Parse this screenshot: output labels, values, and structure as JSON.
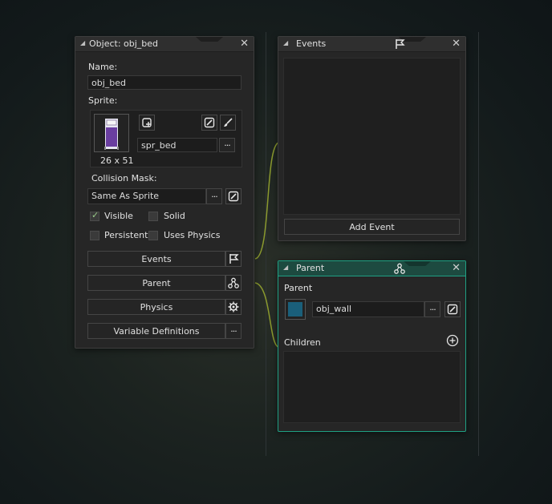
{
  "object_panel": {
    "title": "Object: obj_bed",
    "name_label": "Name:",
    "name_value": "obj_bed",
    "sprite_label": "Sprite:",
    "sprite_name": "spr_bed",
    "sprite_size": "26 x 51",
    "collision_label": "Collision Mask:",
    "collision_value": "Same As Sprite",
    "checkboxes": [
      {
        "label": "Visible",
        "checked": true
      },
      {
        "label": "Solid",
        "checked": false
      },
      {
        "label": "Persistent",
        "checked": false
      },
      {
        "label": "Uses Physics",
        "checked": false
      }
    ],
    "buttons": {
      "events": "Events",
      "parent": "Parent",
      "physics": "Physics",
      "variable_definitions": "Variable Definitions"
    },
    "more_label": "···"
  },
  "events_panel": {
    "title": "Events",
    "add_event": "Add Event"
  },
  "parent_panel": {
    "title": "Parent",
    "parent_label": "Parent",
    "parent_value": "obj_wall",
    "children_label": "Children",
    "more_label": "···"
  },
  "colors": {
    "accent_teal": "#1fa083",
    "connector": "#8b9a2e",
    "sprite_purple": "#6a3ea0",
    "parent_swatch": "#1a5f7a"
  },
  "icons": [
    "close-icon",
    "collapse-triangle-icon",
    "flag-icon",
    "parent-tree-icon",
    "physics-gear-icon",
    "new-sprite-icon",
    "edit-icon",
    "brush-icon",
    "add-circle-icon"
  ]
}
